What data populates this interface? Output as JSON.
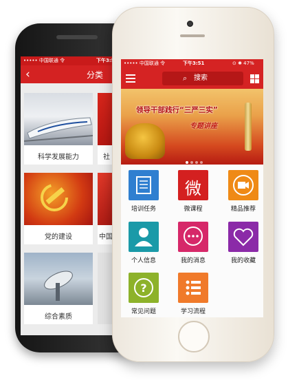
{
  "back_screen": {
    "status_carrier": "••••• 中国联通 令",
    "status_time": "下午3:52",
    "nav_title": "分类",
    "categories": [
      {
        "label": "科学发展能力"
      },
      {
        "label": "社"
      },
      {
        "label": "党的建设"
      },
      {
        "label": "中国"
      },
      {
        "label": "综合素质"
      }
    ]
  },
  "front_screen": {
    "status_carrier": "••••• 中国联通 令",
    "status_time": "下午3:51",
    "status_battery": "⊙ ✱ 47%",
    "search_placeholder": "搜索",
    "banner_title": "领导干部践行“三严三实”",
    "banner_subtitle": "专题讲座",
    "tiles": [
      {
        "label": "培训任务",
        "icon": "scroll-icon",
        "color": "#2f7fd0"
      },
      {
        "label": "微课程",
        "icon": "wei-character-icon",
        "color": "#d42020",
        "glyph": "微"
      },
      {
        "label": "精品推荐",
        "icon": "video-camera-icon",
        "color": "#ef8a16"
      },
      {
        "label": "个人信息",
        "icon": "person-icon",
        "color": "#1a9aa8"
      },
      {
        "label": "我的消息",
        "icon": "chat-bubble-icon",
        "color": "#d62869"
      },
      {
        "label": "我的收藏",
        "icon": "heart-icon",
        "color": "#8b2aa8"
      },
      {
        "label": "常见问题",
        "icon": "question-icon",
        "color": "#8db22a"
      },
      {
        "label": "学习流程",
        "icon": "list-icon",
        "color": "#f07a2a"
      }
    ]
  }
}
